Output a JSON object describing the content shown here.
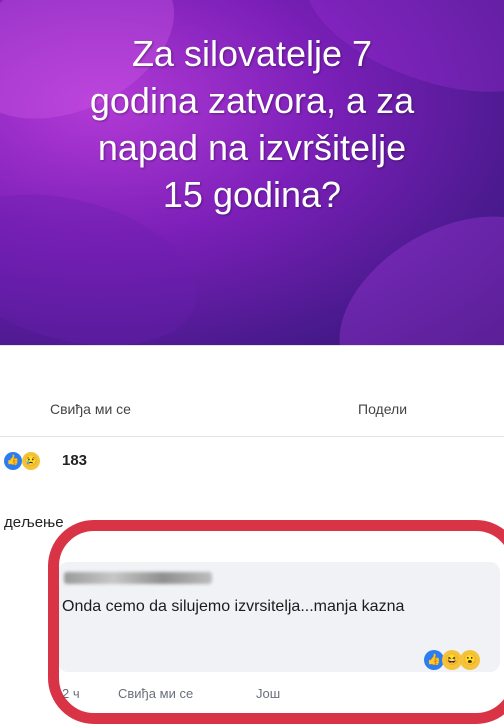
{
  "banner": {
    "lines": [
      "Za silovatelje 7",
      "godina zatvora, a za",
      "napad na izvršitelje",
      "15 godina?"
    ]
  },
  "actions": {
    "like_label": "Свиђа ми се",
    "share_label": "Подели"
  },
  "reactions": {
    "count": "183",
    "like_icon": "like-icon",
    "sad_icon": "sad-icon"
  },
  "shares": {
    "label": "дељење"
  },
  "comment": {
    "text": "Onda cemo da silujemo izvrsitelja...manja kazna",
    "footer_time": "2 ч",
    "footer_like": "Свиђа ми се",
    "footer_more": "Још"
  },
  "colors": {
    "banner_bg": "#7b1fb8",
    "highlight": "#d62236",
    "like_blue": "#2a7ef2",
    "emoji_yellow": "#f5c33b"
  }
}
